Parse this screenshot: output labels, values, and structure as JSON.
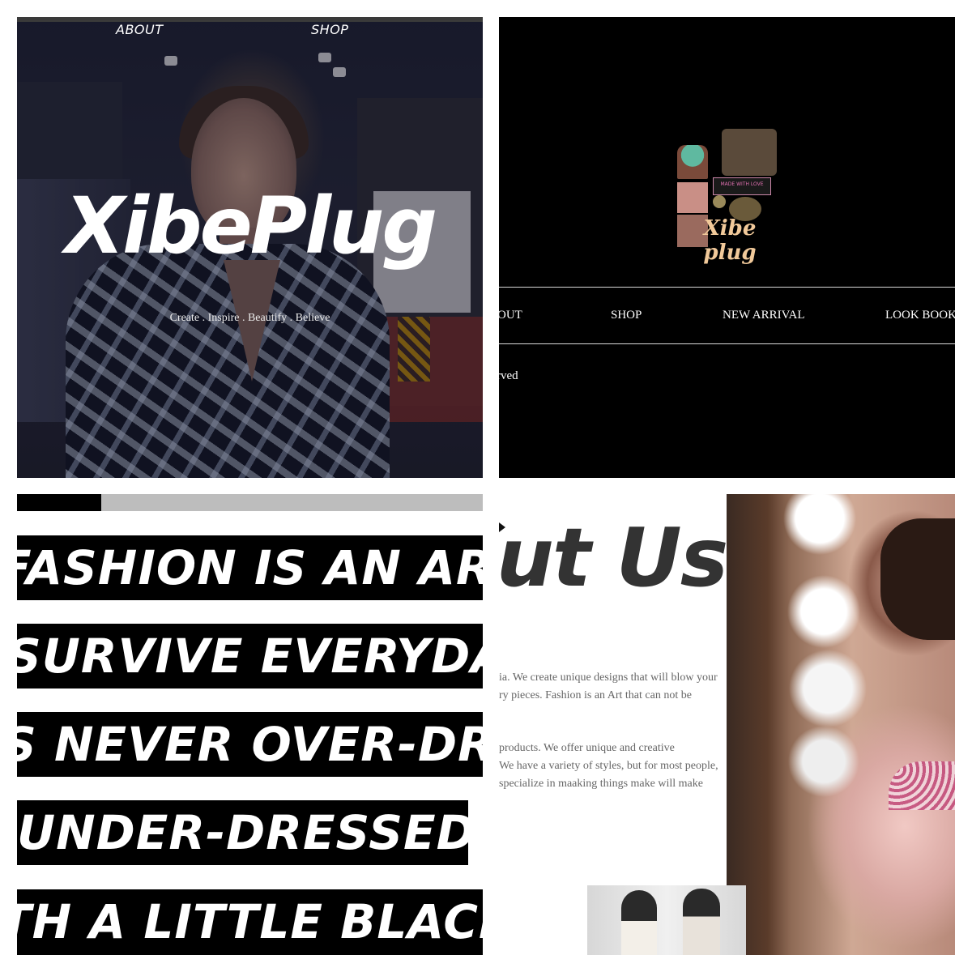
{
  "hero": {
    "nav": [
      "ABOUT",
      "SHOP"
    ],
    "brand": "XibePlug",
    "tagline": "Create . Inspire . Beautify . Believe"
  },
  "header": {
    "logo_text": "Xibe plug",
    "logo_subtext": "MADE WITH LOVE",
    "menu": [
      "BOUT",
      "SHOP",
      "NEW ARRIVAL",
      "LOOK BOOK"
    ],
    "footer_text": "rved"
  },
  "quotes": {
    "progress_percent": 18,
    "lines": [
      "FASHION IS AN ARMOU",
      "SURVIVE EVERYDAY L",
      "S NEVER OVER-DRESS",
      "UNDER-DRESSED",
      "TH A LITTLE BLACK DR"
    ]
  },
  "about": {
    "title": "out Us",
    "para1": [
      "ia. We create unique designs that will blow your",
      "ry pieces. Fashion is an Art that can not be"
    ],
    "para2": [
      " products. We offer unique and creative",
      "We have a variety of styles, but for most people,",
      "specialize in maaking things make will make"
    ]
  },
  "colors": {
    "dark": "#000000",
    "accent_gold": "#f1c99a",
    "progress_track": "#bdbdbd",
    "text_gray": "#666666"
  }
}
